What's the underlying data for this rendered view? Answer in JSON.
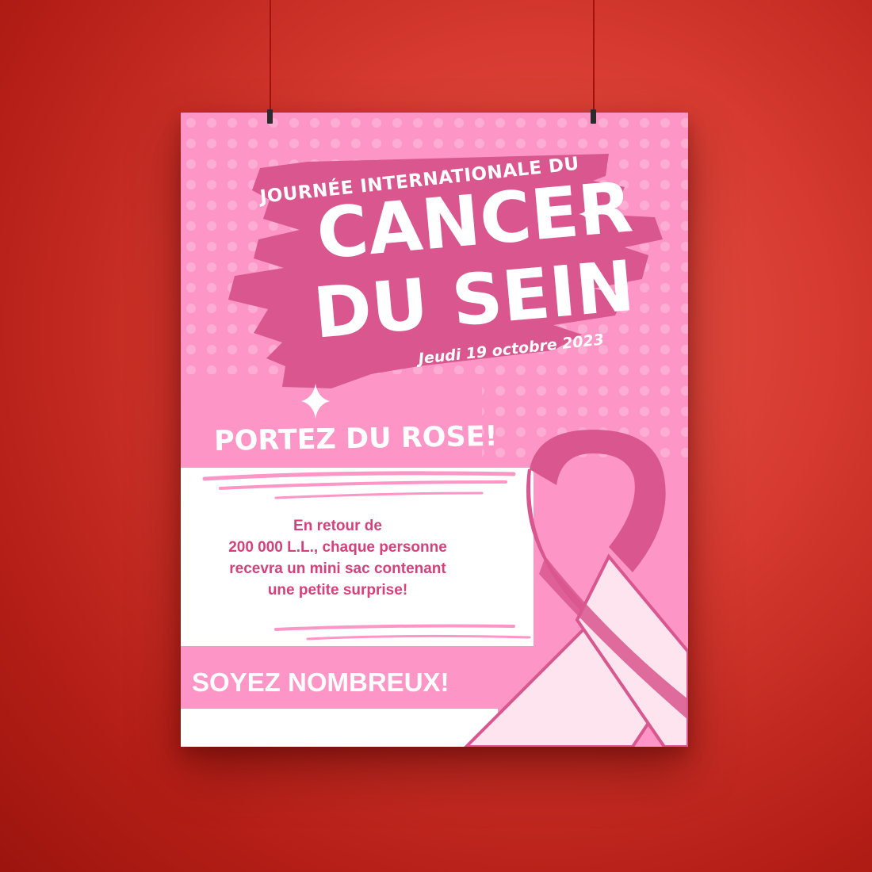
{
  "poster": {
    "subtitle": "JOURNÉE INTERNATIONALE DU",
    "title_line1": "CANCER",
    "title_line2": "DU SEIN",
    "date": "Jeudi 19 octobre 2023",
    "call_to_action": "PORTEZ DU ROSE!",
    "body": [
      "En retour de",
      "200 000 L.L., chaque personne",
      "recevra un mini sac contenant",
      "une petite surprise!"
    ],
    "closing": "SOYEZ NOMBREUX!"
  },
  "colors": {
    "background_red": "#d63a30",
    "poster_pink": "#fd96c6",
    "accent_magenta": "#d9568e",
    "text_magenta": "#d6407c",
    "ribbon_light": "#fde4ef",
    "white": "#ffffff"
  },
  "icons": [
    "sparkle-icon",
    "pink-ribbon-icon"
  ]
}
